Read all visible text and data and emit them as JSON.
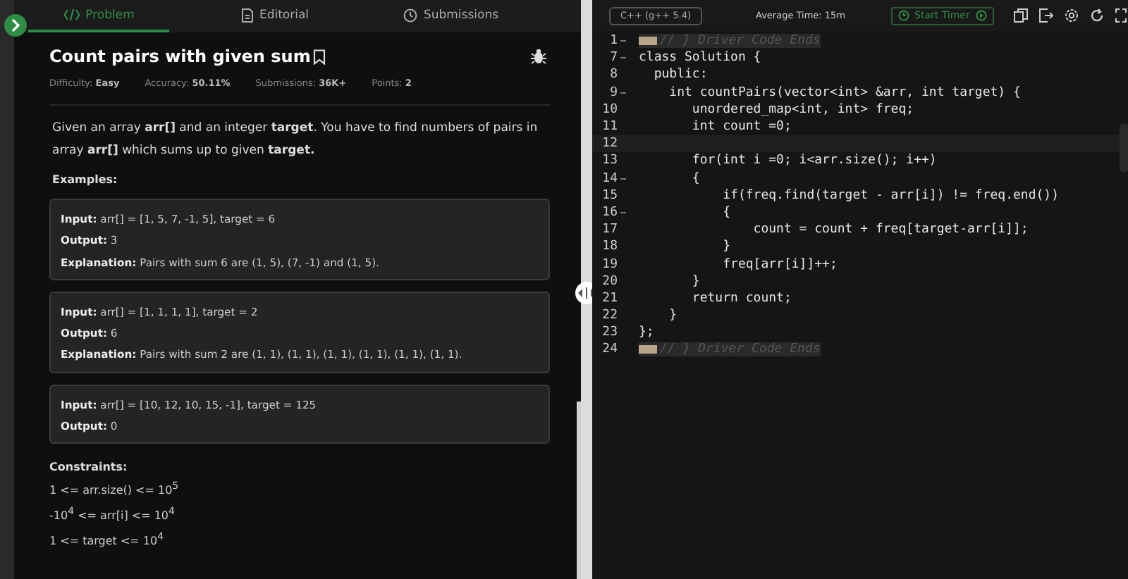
{
  "tabs": [
    {
      "label": "Problem",
      "selected": true
    },
    {
      "label": "Editorial",
      "selected": false
    },
    {
      "label": "Submissions",
      "selected": false
    }
  ],
  "problem": {
    "title": "Count pairs with given sum",
    "meta": [
      "Difficulty: **Easy**",
      "Accuracy: **50.11%**",
      "Submissions: **36K+**",
      "Points: **2**"
    ],
    "description": "Given an array **arr[]** and an integer **target**. You have to find numbers of pairs in array **arr[]** which sums up to given **target.**",
    "examples_heading": "Examples:",
    "examples": [
      [
        "**Input:** arr[] = [1, 5, 7, -1, 5], target = 6",
        "**Output:** 3",
        "**Explanation:** Pairs with sum 6 are (1, 5), (7, -1) and (1, 5)."
      ],
      [
        "**Input:** arr[] = [1, 1, 1, 1], target = 2",
        "**Output:** 6",
        "**Explanation:** Pairs with sum 2 are (1, 1), (1, 1), (1, 1), (1, 1), (1, 1), (1, 1)."
      ],
      [
        "**Input:** arr[] = [10, 12, 10, 15, -1], target = 125",
        "**Output:** 0"
      ]
    ],
    "constraints_heading": "Constraints:",
    "constraints": [
      "1 <= arr.size() <= 10$^{5}$",
      "-10$^{4}$ <= arr[i] <= 10$^{4}$",
      "1 <= target <= 10$^{4}$"
    ]
  },
  "editor": {
    "language": "C++ (g++ 5.4)",
    "average_time": "Average Time: 15m",
    "timer_button": "Start Timer",
    "lines": [
      {
        "n": "1",
        "kind": "comment",
        "text": "// } Driver Code Ends",
        "fold": true,
        "active": false
      },
      {
        "n": "7",
        "kind": "code",
        "text": "class Solution {",
        "fold": true,
        "active": false
      },
      {
        "n": "8",
        "kind": "code",
        "text": "  public:",
        "fold": false,
        "active": false
      },
      {
        "n": "9",
        "kind": "code",
        "text": "    int countPairs(vector<int> &arr, int target) {",
        "fold": true,
        "active": false
      },
      {
        "n": "10",
        "kind": "code",
        "text": "       unordered_map<int, int> freq;",
        "fold": false,
        "active": false
      },
      {
        "n": "11",
        "kind": "code",
        "text": "       int count =0;",
        "fold": false,
        "active": false
      },
      {
        "n": "12",
        "kind": "code",
        "fold": false,
        "active": true
      },
      {
        "n": "13",
        "kind": "code",
        "text": "       for(int i =0; i<arr.size(); i++)",
        "fold": false,
        "active": false
      },
      {
        "n": "14",
        "kind": "code",
        "text": "       {",
        "fold": true,
        "active": false
      },
      {
        "n": "15",
        "kind": "code",
        "text": "           if(freq.find(target - arr[i]) != freq.end())",
        "fold": false,
        "active": false
      },
      {
        "n": "16",
        "kind": "code",
        "text": "           {",
        "fold": true,
        "active": false
      },
      {
        "n": "17",
        "kind": "code",
        "text": "               count = count + freq[target-arr[i]];",
        "fold": false,
        "active": false
      },
      {
        "n": "18",
        "kind": "code",
        "text": "           }",
        "fold": false,
        "active": false
      },
      {
        "n": "19",
        "kind": "code",
        "text": "           freq[arr[i]]++;",
        "fold": false,
        "active": false
      },
      {
        "n": "20",
        "kind": "code",
        "text": "       }",
        "fold": false,
        "active": false
      },
      {
        "n": "21",
        "kind": "code",
        "text": "       return count;",
        "fold": false,
        "active": false
      },
      {
        "n": "22",
        "kind": "code",
        "text": "    }",
        "fold": false,
        "active": false
      },
      {
        "n": "23",
        "kind": "code",
        "text": "};",
        "fold": false,
        "active": false
      },
      {
        "n": "24",
        "kind": "comment",
        "text": "// } Driver Code Ends",
        "fold": false,
        "active": false
      }
    ]
  }
}
